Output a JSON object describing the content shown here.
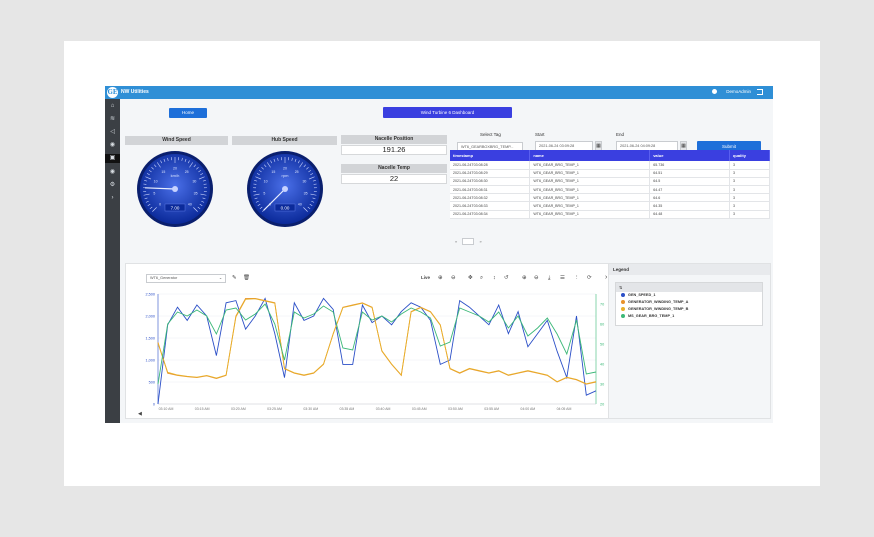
{
  "header": {
    "app_title": "NW Utilities",
    "user_name": "DemoAdmin"
  },
  "sidebar": {
    "icons": [
      "home-icon",
      "layers-icon",
      "volume-icon",
      "gauge-icon",
      "dashboard-icon",
      "gauge-icon-2",
      "settings-icon",
      "chevron-right-icon"
    ]
  },
  "toolbar": {
    "home_label": "Home",
    "dashboard_label": "Wind Turbine 6 Dashboard"
  },
  "gauges": [
    {
      "title": "Wind Speed",
      "value": 7.0,
      "unit": "km/h",
      "max": 40,
      "readout": "7.00"
    },
    {
      "title": "Hub Speed",
      "value": 0.0,
      "unit": "rpm",
      "max": 40,
      "readout": "0.00"
    }
  ],
  "nacelle": {
    "position_title": "Nacelle Position",
    "position_value": "191.26",
    "temp_title": "Nacelle Temp",
    "temp_value": "22"
  },
  "query": {
    "tag_label": "Select Tag",
    "tag_value": "WT6_GEARBOXBRG_TEMP...",
    "start_label": "Start",
    "start_value": "2021-06-24 03:09:28",
    "end_label": "End",
    "end_value": "2021-06-24 04:09:28",
    "submit_label": "Submit"
  },
  "table": {
    "headers": [
      "timestamp",
      "name",
      "value",
      "quality"
    ],
    "rows": [
      [
        "2021-06-24T03:08:28",
        "WT6_GEAR_BRG_TEMP_1",
        "65.736",
        "3"
      ],
      [
        "2021-06-24T03:08:29",
        "WT6_GEAR_BRG_TEMP_1",
        "64.51",
        "3"
      ],
      [
        "2021-06-24T03:08:30",
        "WT6_GEAR_BRG_TEMP_1",
        "64.5",
        "3"
      ],
      [
        "2021-06-24T03:08:31",
        "WT6_GEAR_BRG_TEMP_1",
        "64.47",
        "3"
      ],
      [
        "2021-06-24T03:08:32",
        "WT6_GEAR_BRG_TEMP_1",
        "64.6",
        "3"
      ],
      [
        "2021-06-24T03:08:33",
        "WT6_GEAR_BRG_TEMP_1",
        "64.35",
        "3"
      ],
      [
        "2021-06-24T03:08:34",
        "WT6_GEAR_BRG_TEMP_1",
        "64.48",
        "3"
      ]
    ],
    "pager": {
      "prev": "«",
      "next": "»"
    }
  },
  "chart_toolbar": {
    "select_value": "WT6_Generator",
    "live_label": "Live"
  },
  "chart_data": {
    "type": "line",
    "xlabel": "",
    "ylabel": "",
    "x_ticks": [
      "03:10 AM",
      "03:15 AM",
      "03:20 AM",
      "03:25 AM",
      "03:30 AM",
      "03:35 AM",
      "03:40 AM",
      "03:45 AM",
      "03:50 AM",
      "03:55 AM",
      "04:00 AM",
      "04:05 AM"
    ],
    "left_axis": {
      "ticks": [
        "0",
        "500",
        "1,000",
        "1,500",
        "2,000",
        "2,500"
      ],
      "range": [
        0,
        2500
      ]
    },
    "right_axis": {
      "ticks": [
        "20",
        "30",
        "40",
        "50",
        "60",
        "70"
      ],
      "range": [
        20,
        75
      ]
    },
    "grid": true,
    "series": [
      {
        "name": "GEN_SPEED_1",
        "color": "#2b4fc7",
        "axis": "left",
        "values": [
          0,
          1800,
          2200,
          1900,
          2250,
          2000,
          1100,
          2300,
          2350,
          1700,
          2000,
          2400,
          1600,
          600,
          2300,
          1900,
          2000,
          2400,
          2150,
          900,
          900,
          2250,
          1850,
          2000,
          1800,
          2100,
          2300,
          2200,
          1900,
          900,
          1000,
          2350,
          2200,
          2000,
          1800,
          2250,
          1600,
          2100,
          1300,
          1600,
          1900,
          1200,
          600,
          2000,
          200,
          300
        ]
      },
      {
        "name": "GENERATOR_WINDING_TEMP_A",
        "color": "#e8922b",
        "axis": "left",
        "values": [
          1400,
          700,
          650,
          620,
          600,
          640,
          580,
          650,
          2000,
          2400,
          2400,
          2350,
          2300,
          800,
          700,
          650,
          700,
          900,
          1600,
          2200,
          2250,
          2300,
          2200,
          1200,
          900,
          650,
          2100,
          2200,
          2100,
          1800,
          800,
          700,
          800,
          750,
          700,
          750,
          650,
          700,
          750,
          700,
          650,
          500,
          600,
          550,
          450,
          500
        ]
      },
      {
        "name": "GENERATOR_WINDING_TEMP_B",
        "color": "#e8b02b",
        "axis": "left",
        "values": [
          1380,
          720,
          660,
          630,
          610,
          650,
          590,
          660,
          1980,
          2380,
          2390,
          2340,
          2290,
          810,
          710,
          660,
          710,
          910,
          1590,
          2190,
          2240,
          2290,
          2190,
          1210,
          910,
          660,
          2090,
          2190,
          2090,
          1790,
          810,
          710,
          810,
          760,
          710,
          760,
          660,
          710,
          760,
          710,
          660,
          510,
          610,
          560,
          460,
          510
        ]
      },
      {
        "name": "MS_GEAR_BRG_TEMP_1",
        "color": "#3cb878",
        "axis": "right",
        "values": [
          30,
          60,
          66,
          64,
          67,
          64,
          55,
          67,
          68,
          62,
          65,
          70,
          60,
          42,
          66,
          63,
          65,
          69,
          66,
          48,
          47,
          66,
          62,
          64,
          61,
          65,
          68,
          66,
          63,
          49,
          51,
          68,
          66,
          64,
          61,
          66,
          58,
          64,
          54,
          58,
          63,
          55,
          45,
          62,
          35,
          36
        ]
      }
    ]
  },
  "legend": {
    "title": "Legend",
    "group_label": "⇅",
    "items": [
      {
        "name": "GEN_SPEED_1",
        "color": "#2b4fc7"
      },
      {
        "name": "GENERATOR_WINDING_TEMP_A",
        "color": "#e8922b"
      },
      {
        "name": "GENERATOR_WINDING_TEMP_B",
        "color": "#e8b02b"
      },
      {
        "name": "MS_GEAR_BRG_TEMP_1",
        "color": "#3cb878"
      }
    ]
  }
}
